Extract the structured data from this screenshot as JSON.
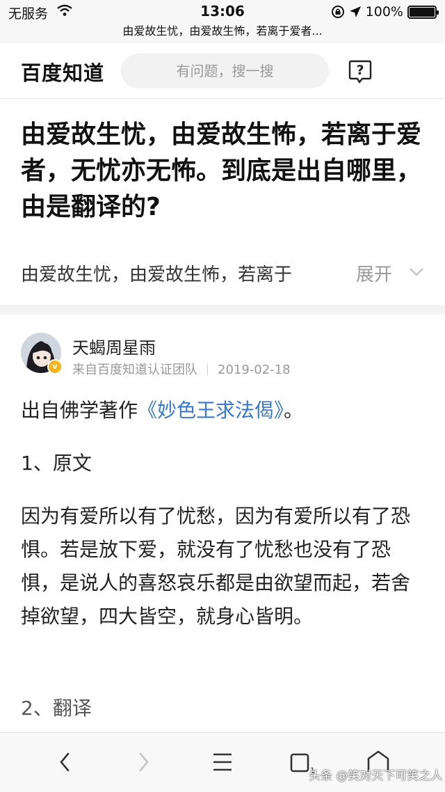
{
  "status_bar": {
    "carrier": "无服务",
    "time": "13:06",
    "battery": "100%",
    "battery_level": 1.0
  },
  "url_bar": {
    "title": "由爱故生忧，由爱故生怖，若离于爱者..."
  },
  "header": {
    "logo": "百度知道",
    "search_placeholder": "有问题，搜一搜",
    "help_icon": "question-bubble-icon"
  },
  "question": {
    "title": "由爱故生忧，由爱故生怖，若离于爱者，无忧亦无怖。到底是出自哪里，由是翻译的?",
    "summary": "由爱故生忧，由爱故生怖，若离于",
    "expand_label": "展开"
  },
  "answer": {
    "author_name": "天蝎周星雨",
    "source": "来自百度知道认证团队",
    "date": "2019-02-18",
    "verified_mark": "v",
    "source_prefix": "出自佛学著作",
    "book_title": "《妙色王求法偈》",
    "source_suffix": "。",
    "heading1": "1、原文",
    "body": "因为有爱所以有了忧愁，因为有爱所以有了恐惧。若是放下爱，就没有了忧愁也没有了恐惧，是说人的喜怒哀乐都是由欲望而起，若舍掉欲望，四大皆空，就身心皆明。",
    "heading2": "2、翻译"
  },
  "toolbar": {
    "icons": [
      "back-icon",
      "forward-icon",
      "menu-icon",
      "tabs-icon",
      "home-icon"
    ]
  },
  "watermark": "头条 @笑对天下可笑之人",
  "colors": {
    "link": "#3377dd",
    "badge": "#f5b51b"
  }
}
